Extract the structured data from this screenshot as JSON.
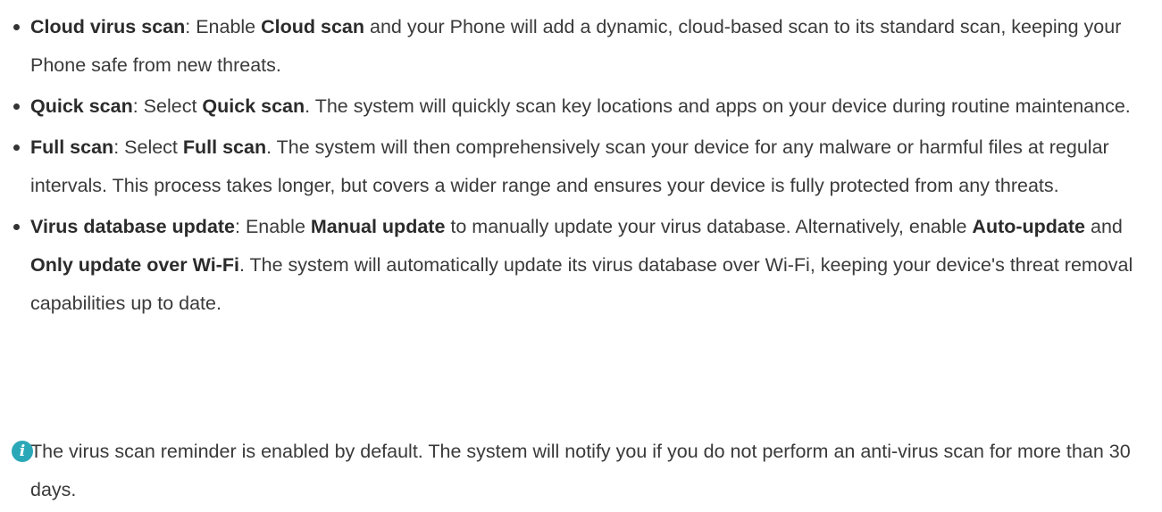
{
  "bullets": [
    {
      "parts": [
        {
          "text": "Cloud virus scan",
          "bold": true
        },
        {
          "text": ": Enable ",
          "bold": false
        },
        {
          "text": "Cloud scan",
          "bold": true
        },
        {
          "text": " and your Phone will add a dynamic, cloud-based scan to its standard scan, keeping your Phone safe from new threats.",
          "bold": false
        }
      ]
    },
    {
      "parts": [
        {
          "text": "Quick scan",
          "bold": true
        },
        {
          "text": ": Select ",
          "bold": false
        },
        {
          "text": "Quick scan",
          "bold": true
        },
        {
          "text": ". The system will quickly scan key locations and apps on your device during routine maintenance.",
          "bold": false
        }
      ]
    },
    {
      "parts": [
        {
          "text": "Full scan",
          "bold": true
        },
        {
          "text": ": Select ",
          "bold": false
        },
        {
          "text": "Full scan",
          "bold": true
        },
        {
          "text": ". The system will then comprehensively scan your device for any malware or harmful files at regular intervals. This process takes longer, but covers a wider range and ensures your device is fully protected from any threats.",
          "bold": false
        }
      ]
    },
    {
      "parts": [
        {
          "text": "Virus database update",
          "bold": true
        },
        {
          "text": ": Enable ",
          "bold": false
        },
        {
          "text": "Manual update",
          "bold": true
        },
        {
          "text": " to manually update your virus database. Alternatively, enable ",
          "bold": false
        },
        {
          "text": "Auto-update",
          "bold": true
        },
        {
          "text": " and ",
          "bold": false
        },
        {
          "text": "Only update over Wi-Fi",
          "bold": true
        },
        {
          "text": ". The system will automatically update its virus database over Wi-Fi, keeping your device's threat removal capabilities up to date.",
          "bold": false
        }
      ]
    }
  ],
  "note": {
    "icon": "info-icon",
    "icon_glyph": "i",
    "icon_color": "#2aa8b7",
    "text": "The virus scan reminder is enabled by default. The system will notify you if you do not perform an anti-virus scan for more than 30 days."
  }
}
